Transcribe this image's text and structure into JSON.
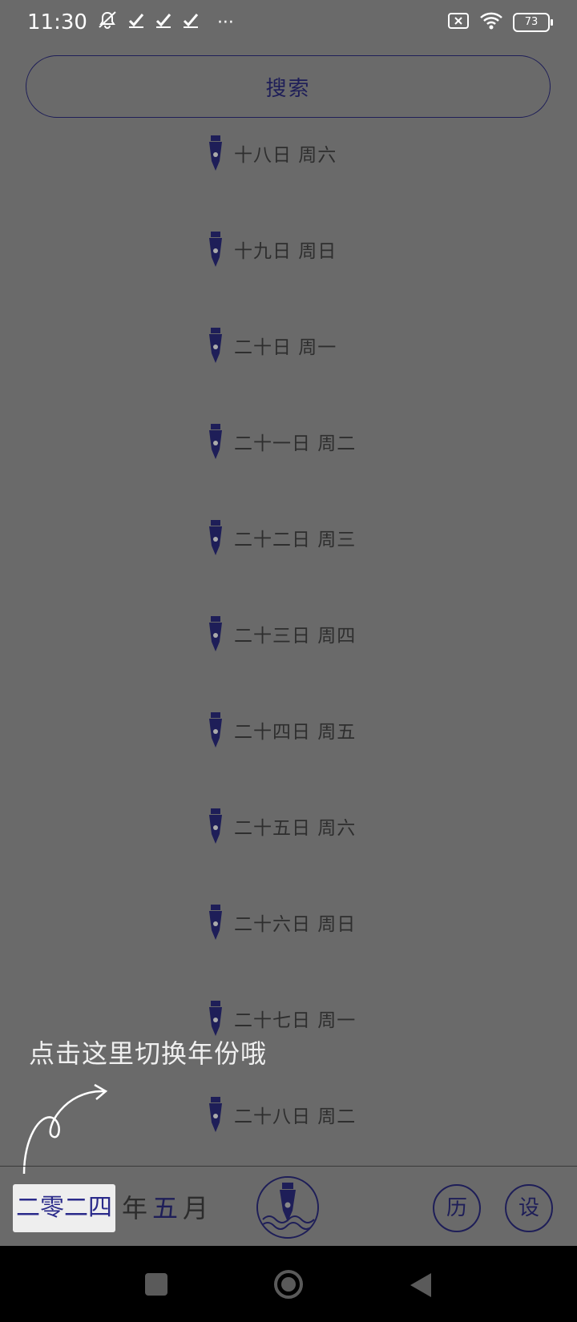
{
  "status_bar": {
    "time": "11:30",
    "icons": [
      "mute-icon",
      "check-icon",
      "check-icon",
      "check-icon",
      "more-dots-icon",
      "sim-off-icon",
      "wifi-icon"
    ],
    "more": "···",
    "battery": "73"
  },
  "search": {
    "label": "搜索"
  },
  "days": [
    "十八日 周六",
    "十九日 周日",
    "二十日 周一",
    "二十一日 周二",
    "二十二日 周三",
    "二十三日 周四",
    "二十四日 周五",
    "二十五日 周六",
    "二十六日 周日",
    "二十七日 周一",
    "二十八日 周二"
  ],
  "hint": {
    "text": "点击这里切换年份哦"
  },
  "bottom_bar": {
    "year": "二零二四",
    "year_suffix": "年",
    "month": "五",
    "month_suffix": "月",
    "calendar_button": "历",
    "settings_button": "设"
  },
  "colors": {
    "accent": "#1e1e58",
    "overlay": "#6a6a6a",
    "nav": "#000000"
  }
}
